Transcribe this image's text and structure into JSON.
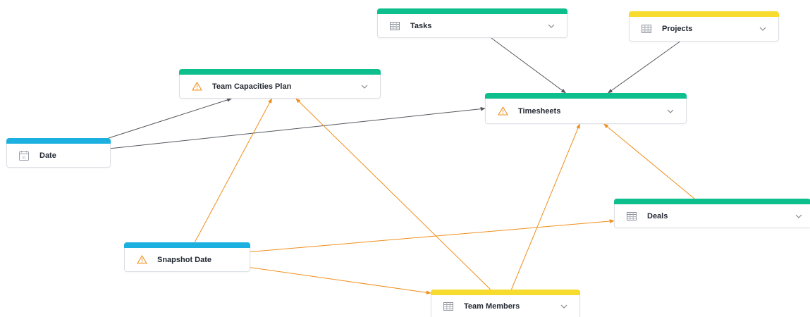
{
  "colors": {
    "green": "#0dbf8c",
    "yellow": "#f7dc2f",
    "blue": "#1cb0e0",
    "edge_gray": "#55595f",
    "edge_orange": "#ef8f1b"
  },
  "nodes": {
    "tasks": {
      "label": "Tasks",
      "icon": "table-icon",
      "bar": "green"
    },
    "projects": {
      "label": "Projects",
      "icon": "table-icon",
      "bar": "yellow"
    },
    "team_capacities_plan": {
      "label": "Team Capacities Plan",
      "icon": "warning-icon",
      "bar": "green"
    },
    "timesheets": {
      "label": "Timesheets",
      "icon": "warning-icon",
      "bar": "green"
    },
    "date": {
      "label": "Date",
      "icon": "calendar-icon",
      "bar": "blue"
    },
    "deals": {
      "label": "Deals",
      "icon": "table-icon",
      "bar": "green"
    },
    "snapshot_date": {
      "label": "Snapshot Date",
      "icon": "warning-icon",
      "bar": "blue"
    },
    "team_members": {
      "label": "Team Members",
      "icon": "table-icon",
      "bar": "yellow"
    }
  },
  "edges": [
    {
      "from": "tasks",
      "to": "timesheets",
      "color": "edge_gray"
    },
    {
      "from": "projects",
      "to": "timesheets",
      "color": "edge_gray"
    },
    {
      "from": "date",
      "to": "team_capacities_plan",
      "color": "edge_gray"
    },
    {
      "from": "date",
      "to": "timesheets",
      "color": "edge_gray"
    },
    {
      "from": "snapshot_date",
      "to": "team_capacities_plan",
      "color": "edge_orange"
    },
    {
      "from": "team_members",
      "to": "team_capacities_plan",
      "color": "edge_orange"
    },
    {
      "from": "team_members",
      "to": "timesheets",
      "color": "edge_orange"
    },
    {
      "from": "deals",
      "to": "timesheets",
      "color": "edge_orange"
    },
    {
      "from": "snapshot_date",
      "to": "deals",
      "color": "edge_orange"
    },
    {
      "from": "snapshot_date",
      "to": "team_members",
      "color": "edge_orange"
    }
  ]
}
